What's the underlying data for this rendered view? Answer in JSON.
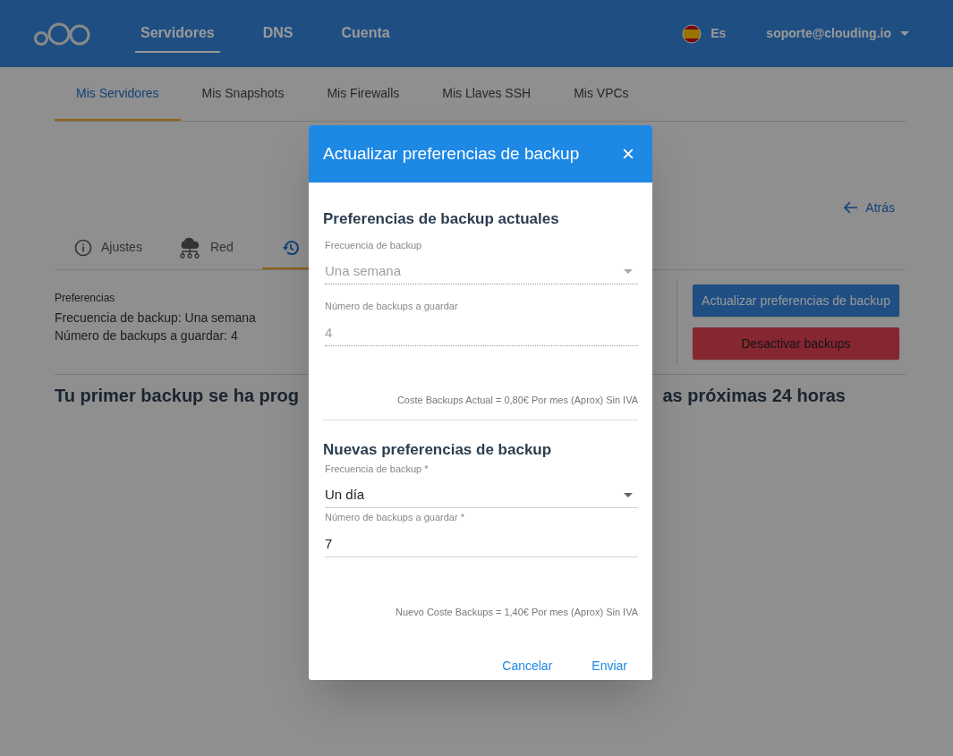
{
  "nav": {
    "items": [
      {
        "label": "Servidores",
        "selected": true
      },
      {
        "label": "DNS",
        "selected": false
      },
      {
        "label": "Cuenta",
        "selected": false
      }
    ],
    "language": "Es",
    "account": "soporte@clouding.io"
  },
  "sub_tabs": [
    {
      "label": "Mis Servidores",
      "selected": true
    },
    {
      "label": "Mis Snapshots",
      "selected": false
    },
    {
      "label": "Mis Firewalls",
      "selected": false
    },
    {
      "label": "Mis Llaves SSH",
      "selected": false
    },
    {
      "label": "Mis VPCs",
      "selected": false
    }
  ],
  "back_link": "Atrás",
  "server_tabs": [
    {
      "kind": "info",
      "label": "Ajustes",
      "selected": false
    },
    {
      "kind": "network",
      "label": "Red",
      "selected": false
    },
    {
      "kind": "history",
      "selected": true
    }
  ],
  "preferences": {
    "title": "Preferencias",
    "lines": [
      "Frecuencia de backup: Una semana",
      "Número de backups a guardar: 4"
    ]
  },
  "actions": [
    {
      "kind": "primary",
      "label": "Actualizar preferencias de backup"
    },
    {
      "kind": "danger",
      "label": "Desactivar backups"
    }
  ],
  "notice": {
    "left": "Tu primer backup se ha prog",
    "right": "as próximas 24 horas"
  },
  "dialog": {
    "title": "Actualizar preferencias de backup",
    "close": "×",
    "sections": [
      {
        "heading": "Preferencias de backup actuales",
        "fields": [
          {
            "kind": "select",
            "label": "Frecuencia de backup",
            "value": "Una semana",
            "disabled": true
          },
          {
            "kind": "text",
            "label": "Número de backups a guardar",
            "value": "4",
            "disabled": true
          }
        ],
        "cost": "Coste Backups Actual = 0,80€ Por mes (Aprox) Sin IVA"
      },
      {
        "heading": "Nuevas preferencias de backup",
        "fields": [
          {
            "kind": "select",
            "label": "Frecuencia de backup *",
            "value": "Un día",
            "disabled": false
          },
          {
            "kind": "text",
            "label": "Número de backups a guardar *",
            "value": "7",
            "disabled": false
          }
        ],
        "cost": "Nuevo Coste Backups = 1,40€ Por mes (Aprox) Sin IVA"
      }
    ],
    "buttons": [
      "Cancelar",
      "Enviar"
    ]
  }
}
